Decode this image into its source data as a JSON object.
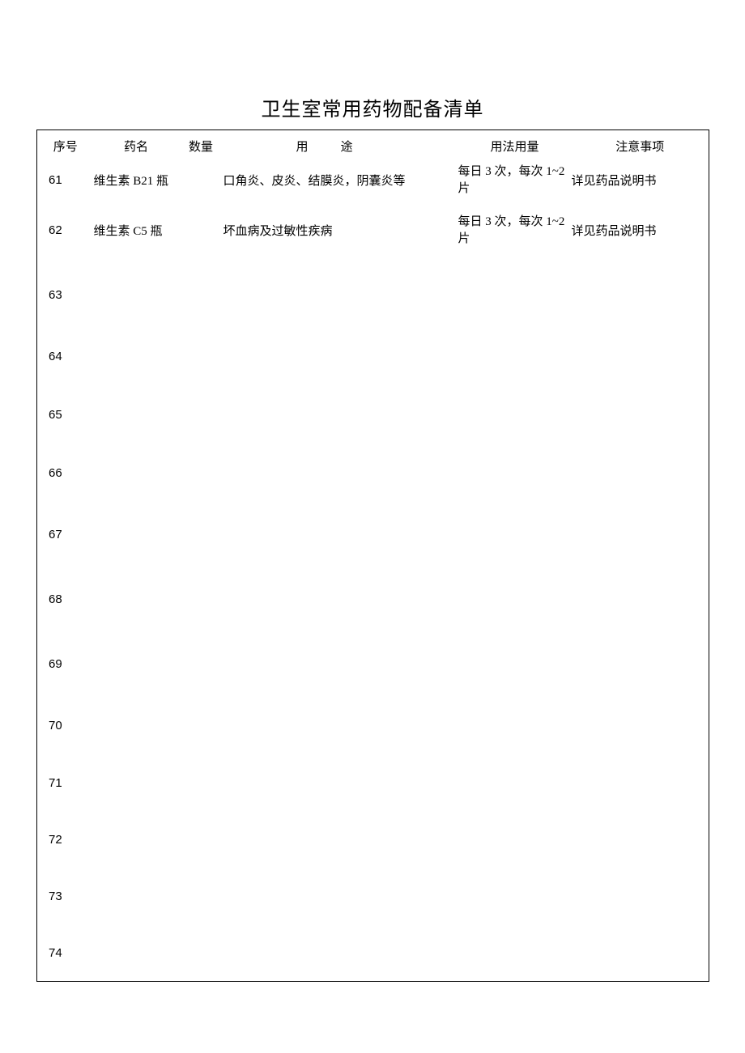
{
  "title": "卫生室常用药物配备清单",
  "headers": {
    "seq": "序号",
    "name": "药名",
    "qty": "数量",
    "use": "用途",
    "dose": "用法用量",
    "note": "注意事项"
  },
  "rows": [
    {
      "seq": "61",
      "name": "维生素 B2",
      "qty": "1 瓶",
      "use": "口角炎、皮炎、结膜炎，阴囊炎等",
      "dose": "每日 3 次，每次 1~2 片",
      "note": "详见药品说明书"
    },
    {
      "seq": "62",
      "name": "维生素 C",
      "qty": "5 瓶",
      "use": "坏血病及过敏性疾病",
      "dose": "每日 3 次，每次 1~2 片",
      "note": "详见药品说明书"
    },
    {
      "seq": "63",
      "name": "",
      "qty": "",
      "use": "",
      "dose": "",
      "note": ""
    },
    {
      "seq": "64",
      "name": "",
      "qty": "",
      "use": "",
      "dose": "",
      "note": ""
    },
    {
      "seq": "65",
      "name": "",
      "qty": "",
      "use": "",
      "dose": "",
      "note": ""
    },
    {
      "seq": "66",
      "name": "",
      "qty": "",
      "use": "",
      "dose": "",
      "note": ""
    },
    {
      "seq": "67",
      "name": "",
      "qty": "",
      "use": "",
      "dose": "",
      "note": ""
    },
    {
      "seq": "68",
      "name": "",
      "qty": "",
      "use": "",
      "dose": "",
      "note": ""
    },
    {
      "seq": "69",
      "name": "",
      "qty": "",
      "use": "",
      "dose": "",
      "note": ""
    },
    {
      "seq": "70",
      "name": "",
      "qty": "",
      "use": "",
      "dose": "",
      "note": ""
    },
    {
      "seq": "71",
      "name": "",
      "qty": "",
      "use": "",
      "dose": "",
      "note": ""
    },
    {
      "seq": "72",
      "name": "",
      "qty": "",
      "use": "",
      "dose": "",
      "note": ""
    },
    {
      "seq": "73",
      "name": "",
      "qty": "",
      "use": "",
      "dose": "",
      "note": ""
    },
    {
      "seq": "74",
      "name": "",
      "qty": "",
      "use": "",
      "dose": "",
      "note": ""
    }
  ]
}
